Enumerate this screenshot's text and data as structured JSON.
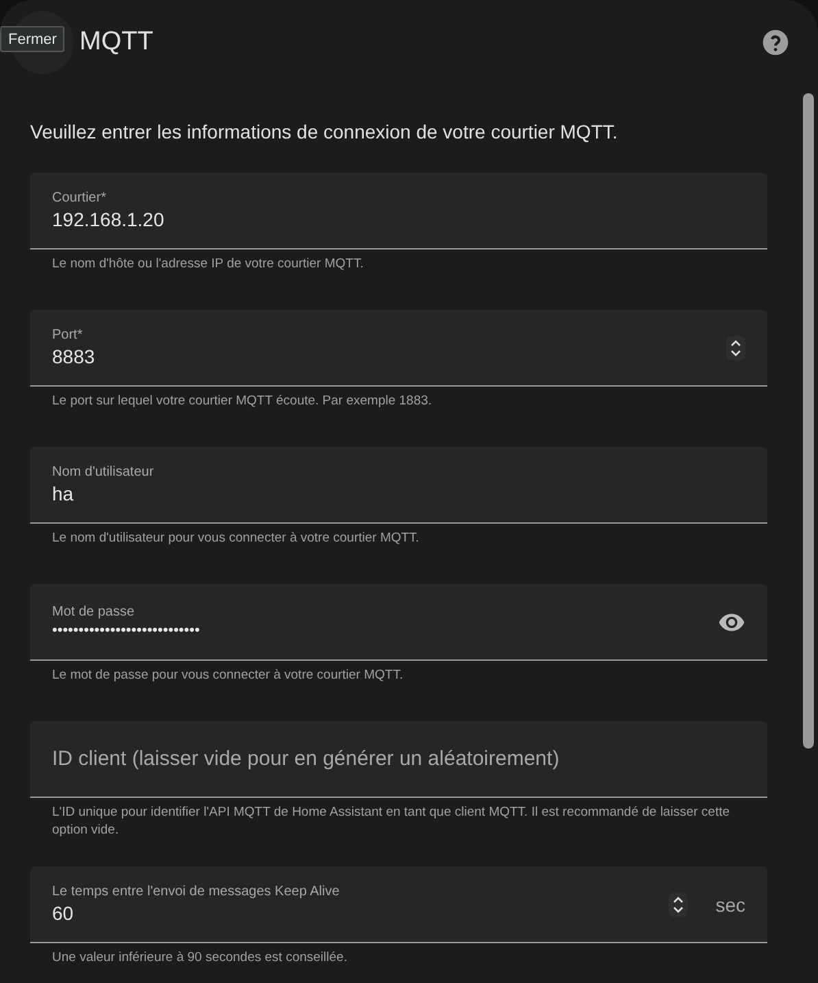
{
  "header": {
    "close_label": "Fermer",
    "title": "MQTT"
  },
  "intro": "Veuillez entrer les informations de connexion de votre courtier MQTT.",
  "fields": [
    {
      "kind": "text",
      "label": "Courtier*",
      "value": "192.168.1.20",
      "helper": "Le nom d'hôte ou l'adresse IP de votre courtier MQTT."
    },
    {
      "kind": "number",
      "label": "Port*",
      "value": "8883",
      "helper": "Le port sur lequel votre courtier MQTT écoute. Par exemple 1883."
    },
    {
      "kind": "text",
      "label": "Nom d'utilisateur",
      "value": "ha",
      "helper": "Le nom d'utilisateur pour vous connecter à votre courtier MQTT."
    },
    {
      "kind": "password",
      "label": "Mot de passe",
      "value": "••••••••••••••••••••••••••••",
      "helper": "Le mot de passe pour vous connecter à votre courtier MQTT."
    },
    {
      "kind": "empty",
      "placeholder": "ID client (laisser vide pour en générer un aléatoirement)",
      "helper": "L'ID unique pour identifier l'API MQTT de Home Assistant en tant que client MQTT. Il est recommandé de laisser cette option vide."
    },
    {
      "kind": "number",
      "label": "Le temps entre l'envoi de messages Keep Alive",
      "value": "60",
      "suffix": "sec",
      "helper": "Une valeur inférieure à 90 secondes est conseillée."
    }
  ]
}
